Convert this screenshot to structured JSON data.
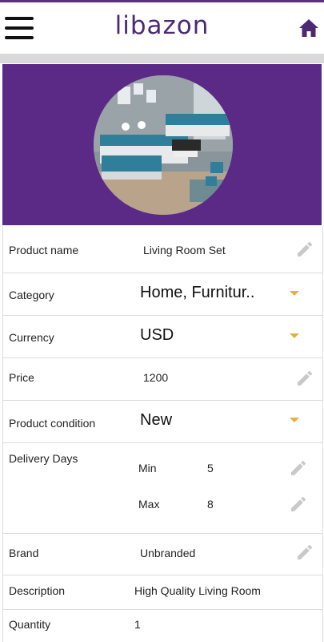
{
  "header": {
    "logo_text": "libazon",
    "menu_icon": "hamburger-menu-icon",
    "home_icon": "home-icon",
    "accent_color": "#5a2f82"
  },
  "banner": {
    "background_color": "#5b2a86",
    "image_alt": "Living room sectional sofa photo"
  },
  "fields": {
    "product_name": {
      "label": "Product name",
      "value": "Living Room Set",
      "icon": "pencil-icon"
    },
    "category": {
      "label": "Category",
      "value": "Home, Furnitur..",
      "icon": "dropdown-caret-icon"
    },
    "currency": {
      "label": "Currency",
      "value": "USD",
      "icon": "dropdown-caret-icon"
    },
    "price": {
      "label": "Price",
      "value": "1200",
      "icon": "pencil-icon"
    },
    "condition": {
      "label": "Product condition",
      "value": "New",
      "icon": "dropdown-caret-icon"
    },
    "delivery": {
      "label": "Delivery Days",
      "min_label": "Min",
      "min_value": "5",
      "max_label": "Max",
      "max_value": "8"
    },
    "brand": {
      "label": "Brand",
      "value": "Unbranded",
      "icon": "pencil-icon"
    },
    "description": {
      "label": "Description",
      "value": "High Quality Living Room"
    },
    "quantity": {
      "label": "Quantity",
      "value": "1"
    }
  }
}
